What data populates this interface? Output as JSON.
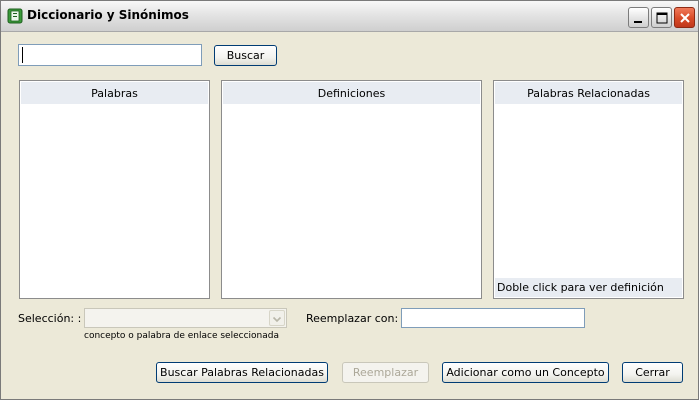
{
  "window": {
    "title": "Diccionario y Sinónimos",
    "icon": "book-app-icon"
  },
  "search": {
    "value": "",
    "button_label": "Buscar"
  },
  "panels": {
    "words": {
      "header": "Palabras"
    },
    "definitions": {
      "header": "Definiciones"
    },
    "related": {
      "header": "Palabras Relacionadas",
      "footer": "Doble click para ver definición"
    }
  },
  "selection": {
    "label": "Selección: :",
    "value": "",
    "hint": "concepto o palabra de  enlace seleccionada"
  },
  "replace": {
    "label": "Reemplazar con:",
    "value": ""
  },
  "actions": {
    "find_related": "Buscar Palabras Relacionadas",
    "replace": "Reemplazar",
    "add_concept": "Adicionar como un Concepto",
    "close": "Cerrar"
  }
}
